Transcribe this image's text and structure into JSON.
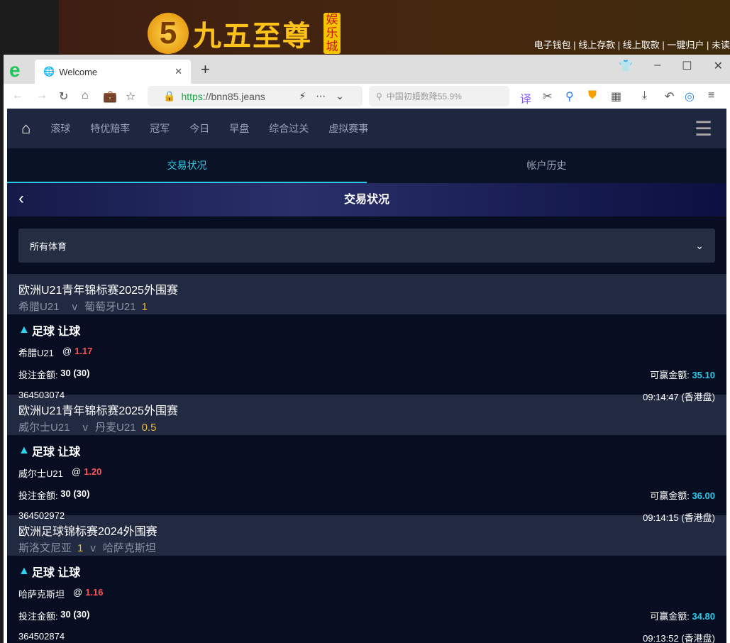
{
  "site": {
    "logo_mark": "5",
    "logo_name": "九五至尊",
    "logo_tag": "娱乐城",
    "top_links": "电子钱包 | 线上存款 | 线上取款 | 一键归户 | 未读"
  },
  "browser": {
    "tab_title": "Welcome",
    "url_scheme": "https",
    "url_rest": "://bnn85.jeans",
    "search_placeholder": "中国初婚数降55.9%"
  },
  "nav": {
    "items": [
      "滚球",
      "特优赔率",
      "冠军",
      "今日",
      "早盘",
      "综合过关",
      "虚拟赛事"
    ]
  },
  "subtabs": [
    "交易状况",
    "帐户历史"
  ],
  "hero_title": "交易状况",
  "filter": "所有体育",
  "bets": [
    {
      "league": "欧洲U21青年锦标赛2025外围赛",
      "home": "希腊U21",
      "away": "葡萄牙U21",
      "hcp_home": "",
      "hcp_away": "1",
      "type": "足球 让球",
      "selection": "希腊U21",
      "odds": "1.17",
      "stake_label": "投注金额:",
      "stake": "30 (30)",
      "win_label": "可赢金额:",
      "win": "35.10",
      "id": "364503074",
      "time": "09:14:47 (香港盘)"
    },
    {
      "league": "欧洲U21青年锦标赛2025外围赛",
      "home": "威尔士U21",
      "away": "丹麦U21",
      "hcp_home": "",
      "hcp_away": "0.5",
      "type": "足球 让球",
      "selection": "威尔士U21",
      "odds": "1.20",
      "stake_label": "投注金额:",
      "stake": "30 (30)",
      "win_label": "可赢金额:",
      "win": "36.00",
      "id": "364502972",
      "time": "09:14:15 (香港盘)"
    },
    {
      "league": "欧洲足球锦标赛2024外围赛",
      "home": "斯洛文尼亚",
      "away": "哈萨克斯坦",
      "hcp_home": "1",
      "hcp_away": "",
      "type": "足球 让球",
      "selection": "哈萨克斯坦",
      "odds": "1.16",
      "stake_label": "投注金额:",
      "stake": "30 (30)",
      "win_label": "可赢金额:",
      "win": "34.80",
      "id": "364502874",
      "time": "09:13:52 (香港盘)"
    }
  ]
}
